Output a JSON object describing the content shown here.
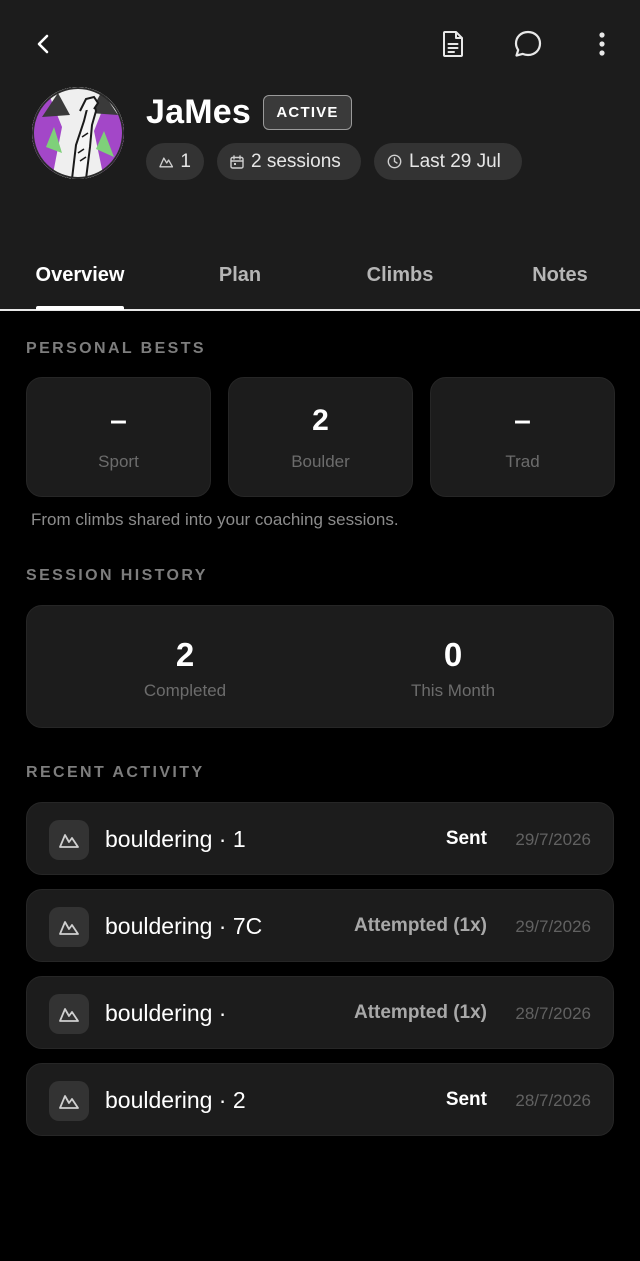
{
  "colors": {
    "header_bg": "#1c1c1c",
    "page_bg": "#000000",
    "card_bg": "#1c1c1c",
    "chip_bg": "#333333",
    "muted_text": "#6c6c6c",
    "section_label": "#7d7d7d"
  },
  "header": {
    "back_icon": "chevron-left-icon",
    "actions": [
      "document-icon",
      "chat-bubble-icon",
      "more-vertical-icon"
    ]
  },
  "profile": {
    "name": "JaMes",
    "status": "ACTIVE",
    "avatar_icon": "climbing-arm-illustration",
    "chips": {
      "climbs": "1",
      "sessions": "2 sessions",
      "last": "Last 29 Jul"
    }
  },
  "tabs": [
    {
      "label": "Overview",
      "active": true
    },
    {
      "label": "Plan",
      "active": false
    },
    {
      "label": "Climbs",
      "active": false
    },
    {
      "label": "Notes",
      "active": false
    }
  ],
  "personal_bests": {
    "title": "PERSONAL BESTS",
    "items": [
      {
        "value": "–",
        "label": "Sport"
      },
      {
        "value": "2",
        "label": "Boulder"
      },
      {
        "value": "–",
        "label": "Trad"
      }
    ],
    "note": "From climbs shared into your coaching sessions."
  },
  "session_history": {
    "title": "SESSION HISTORY",
    "completed": {
      "value": "2",
      "label": "Completed"
    },
    "this_month": {
      "value": "0",
      "label": "This Month"
    }
  },
  "recent_activity": {
    "title": "RECENT ACTIVITY",
    "items": [
      {
        "title": "bouldering · 1",
        "status": "Sent",
        "date": "29/7/2026",
        "status_color": "#ffffff"
      },
      {
        "title": "bouldering · 7C",
        "status": "Attempted (1x)",
        "date": "29/7/2026",
        "status_color": "#a8a8a8"
      },
      {
        "title": "bouldering ·",
        "status": "Attempted (1x)",
        "date": "28/7/2026",
        "status_color": "#a8a8a8"
      },
      {
        "title": "bouldering · 2",
        "status": "Sent",
        "date": "28/7/2026",
        "status_color": "#ffffff"
      }
    ]
  }
}
